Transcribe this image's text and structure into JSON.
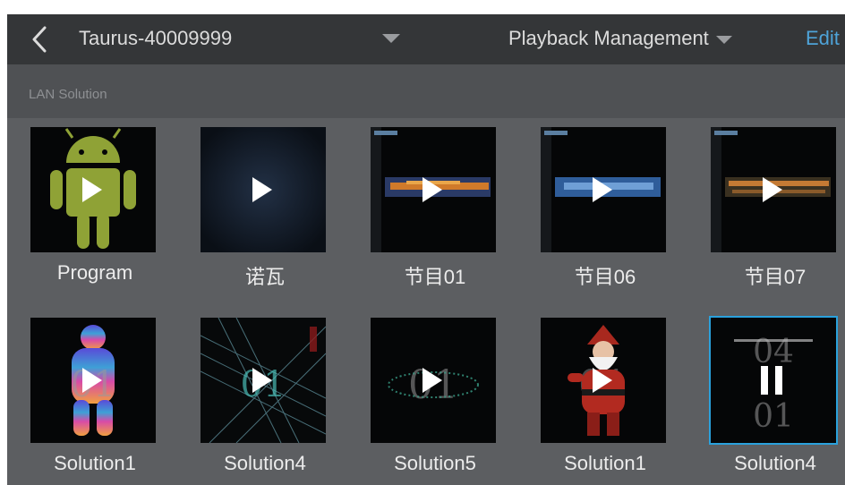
{
  "header": {
    "device_name": "Taurus-40009999",
    "menu_label": "Playback Management",
    "edit_label": "Edit"
  },
  "section": {
    "title": "LAN Solution"
  },
  "colors": {
    "accent": "#2aa1dc",
    "edit": "#4ea3d8",
    "topbar": "#343638",
    "background": "#5c5e61"
  },
  "row1": [
    {
      "label": "Program",
      "art": "android-robot-icon",
      "state": "play"
    },
    {
      "label": "诺瓦",
      "art": "dark-blue-glow",
      "state": "play"
    },
    {
      "label": "节目01",
      "art": "orange-streak",
      "state": "play"
    },
    {
      "label": "节目06",
      "art": "blue-streak",
      "state": "play"
    },
    {
      "label": "节目07",
      "art": "orange-dotted-streak",
      "state": "play"
    }
  ],
  "row2": [
    {
      "label": "Solution1",
      "art": "rainbow-figure",
      "state": "play"
    },
    {
      "label": "Solution4",
      "art": "laser-lines",
      "state": "play"
    },
    {
      "label": "Solution5",
      "art": "01-dotted",
      "state": "play"
    },
    {
      "label": "Solution1",
      "art": "santa-claus",
      "state": "play"
    },
    {
      "label": "Solution4",
      "art": "0401-text",
      "state": "pause",
      "selected": true
    }
  ]
}
